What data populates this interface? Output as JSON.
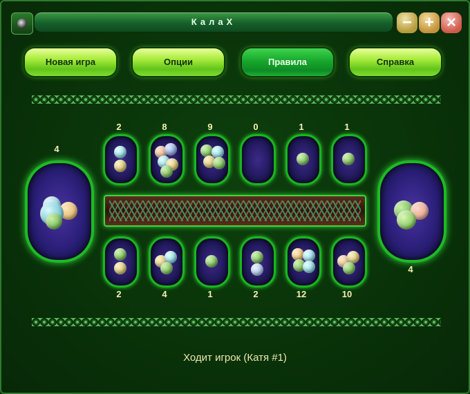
{
  "window": {
    "title": "КалаХ"
  },
  "menu": {
    "new_game": "Новая игра",
    "options": "Опции",
    "rules": "Правила",
    "help": "Справка"
  },
  "board": {
    "top_pits": [
      2,
      8,
      9,
      0,
      1,
      1
    ],
    "bottom_pits": [
      2,
      4,
      1,
      2,
      12,
      10
    ],
    "left_store": 4,
    "right_store": 4
  },
  "status": {
    "text": "Ходит игрок (Катя #1)"
  },
  "colors": {
    "accent": "#1dbb23",
    "pit_fill": "#2a1f78",
    "count_text": "#f6f0b2"
  }
}
